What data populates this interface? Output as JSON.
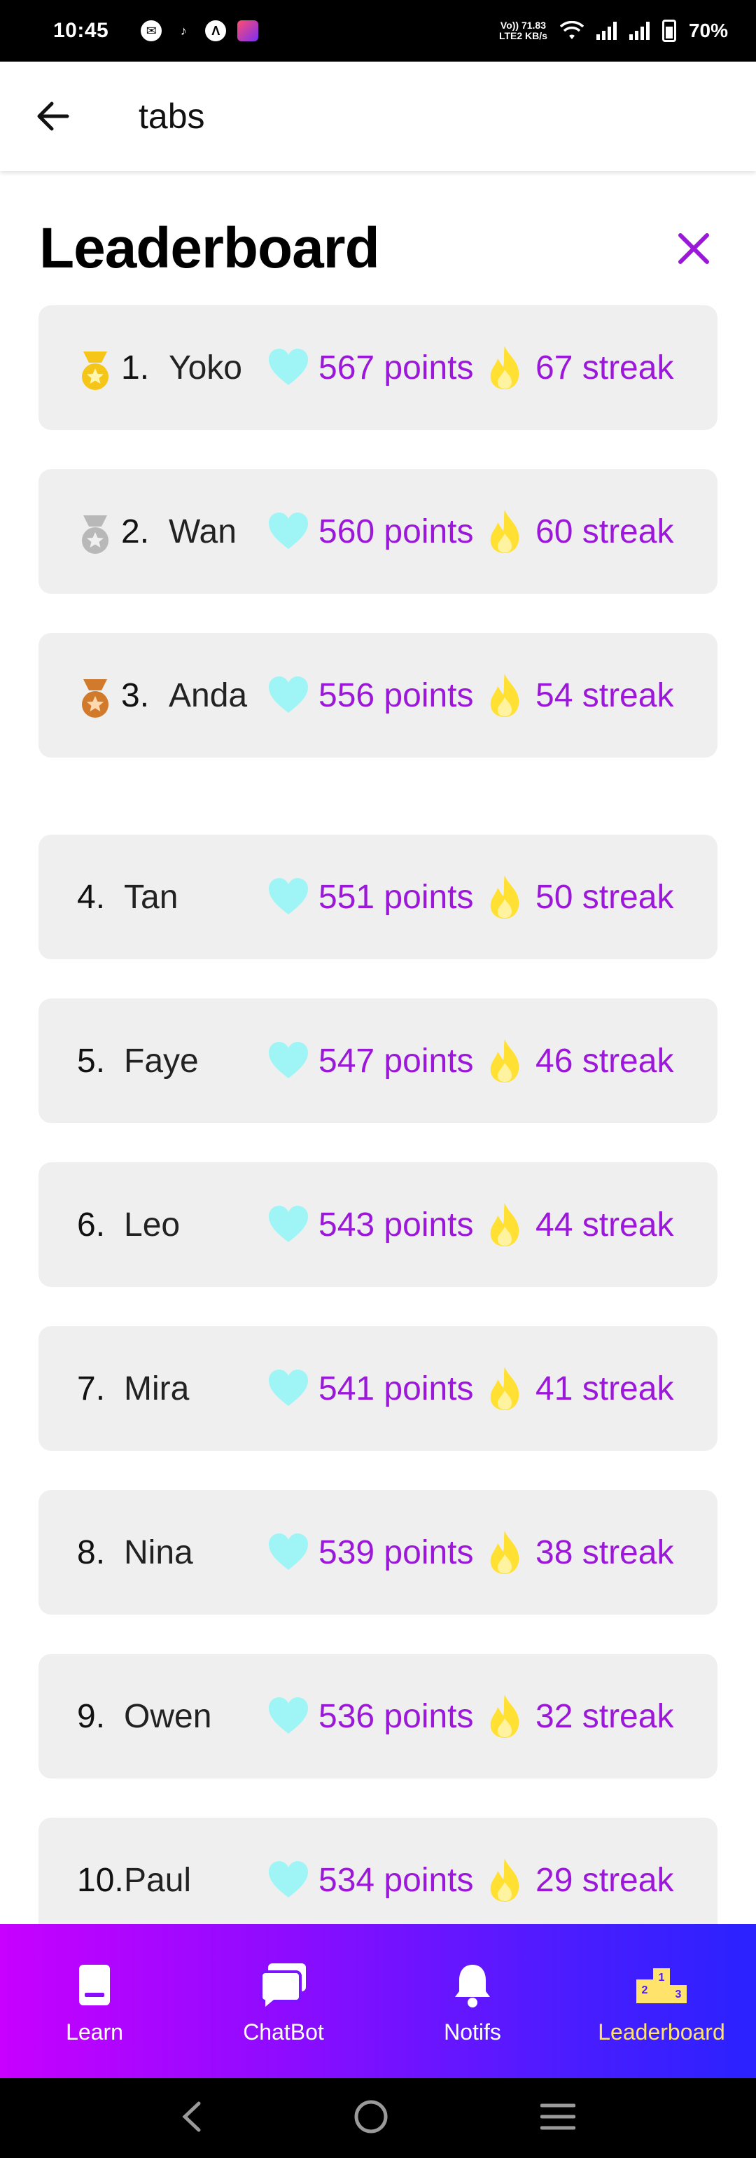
{
  "status_bar": {
    "time": "10:45",
    "network_top": "Vo)) 71.83",
    "network_bottom": "LTE2 KB/s",
    "battery": "70%"
  },
  "app_bar": {
    "title": "tabs",
    "back_icon": "arrow-left-icon"
  },
  "header": {
    "title": "Leaderboard",
    "close_icon": "close-icon",
    "accent": "#9b18d9"
  },
  "leaderboard": [
    {
      "rank": "1.",
      "name": "Yoko",
      "points": "567 points",
      "streak": "67 streak",
      "medal": "gold"
    },
    {
      "rank": "2.",
      "name": "Wan",
      "points": "560 points",
      "streak": "60 streak",
      "medal": "silver"
    },
    {
      "rank": "3.",
      "name": "Anda",
      "points": "556 points",
      "streak": "54 streak",
      "medal": "bronze"
    },
    {
      "rank": "4.",
      "name": "Tan",
      "points": "551 points",
      "streak": "50 streak"
    },
    {
      "rank": "5.",
      "name": "Faye",
      "points": "547 points",
      "streak": "46 streak"
    },
    {
      "rank": "6.",
      "name": "Leo",
      "points": "543 points",
      "streak": "44 streak"
    },
    {
      "rank": "7.",
      "name": "Mira",
      "points": "541 points",
      "streak": "41 streak"
    },
    {
      "rank": "8.",
      "name": "Nina",
      "points": "539 points",
      "streak": "38 streak"
    },
    {
      "rank": "9.",
      "name": "Owen",
      "points": "536 points",
      "streak": "32 streak"
    },
    {
      "rank": "10.",
      "name": "Paul",
      "points": "534 points",
      "streak": "29 streak"
    }
  ],
  "bottom_nav": [
    {
      "label": "Learn",
      "icon": "book-icon",
      "active": false
    },
    {
      "label": "ChatBot",
      "icon": "chat-icon",
      "active": false
    },
    {
      "label": "Notifs",
      "icon": "bell-icon",
      "active": false
    },
    {
      "label": "Leaderboard",
      "icon": "podium-icon",
      "active": true
    }
  ],
  "colors": {
    "points_text": "#9b18d9",
    "heart": "#9ff5f5",
    "flame": "#ffe033",
    "nav_active": "#ffe36a"
  }
}
